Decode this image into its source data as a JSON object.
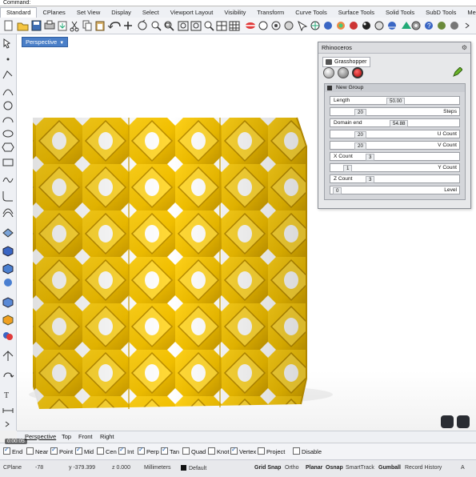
{
  "command": {
    "label": "Command:"
  },
  "menu_tabs": [
    "Standard",
    "CPlanes",
    "Set View",
    "Display",
    "Select",
    "Viewport Layout",
    "Visibility",
    "Transform",
    "Curve Tools",
    "Surface Tools",
    "Solid Tools",
    "SubD Tools",
    "Mesh"
  ],
  "viewport": {
    "title": "Perspective"
  },
  "grasshopper": {
    "window_title": "Rhinoceros",
    "tab_label": "Grasshopper",
    "group_title": "New Group",
    "params": {
      "length": {
        "label": "Length",
        "value": "50.00"
      },
      "steps": {
        "label": "Steps",
        "value": "20"
      },
      "domain_end": {
        "label": "Domain end",
        "value": "54.88"
      },
      "u_count": {
        "label": "U Count",
        "value": "20"
      },
      "v_count": {
        "label": "V Count",
        "value": "20"
      },
      "x_count": {
        "label": "X Count",
        "value": "3"
      },
      "y_count": {
        "label": "Y Count",
        "value": "1"
      },
      "z_count": {
        "label": "Z Count",
        "value": "3"
      },
      "level": {
        "label": "Level",
        "value": "0"
      }
    }
  },
  "viewport_tabs": [
    "Perspective",
    "Top",
    "Front",
    "Right"
  ],
  "osnaps": [
    {
      "label": "End",
      "checked": true
    },
    {
      "label": "Near",
      "checked": false
    },
    {
      "label": "Point",
      "checked": true
    },
    {
      "label": "Mid",
      "checked": true
    },
    {
      "label": "Cen",
      "checked": false
    },
    {
      "label": "Int",
      "checked": true
    },
    {
      "label": "Perp",
      "checked": true
    },
    {
      "label": "Tan",
      "checked": true
    },
    {
      "label": "Quad",
      "checked": false
    },
    {
      "label": "Knot",
      "checked": false
    },
    {
      "label": "Vertex",
      "checked": true
    },
    {
      "label": "Project",
      "checked": false
    },
    {
      "label": "Disable",
      "checked": false
    }
  ],
  "status": {
    "cplane": "CPlane",
    "x": "-78",
    "y": "y -379.399",
    "z": "z 0.000",
    "units": "Millimeters",
    "layer": "Default",
    "grid_snap": "Grid Snap",
    "ortho": "Ortho",
    "planar": "Planar",
    "osnap": "Osnap",
    "smarttrack": "SmartTrack",
    "gumball": "Gumball",
    "record_history": "Record History",
    "filter": "A"
  },
  "video": {
    "time": "0:00:05"
  },
  "colors": {
    "object": "#f2c400",
    "viewport_title": "#4a7fc8"
  }
}
